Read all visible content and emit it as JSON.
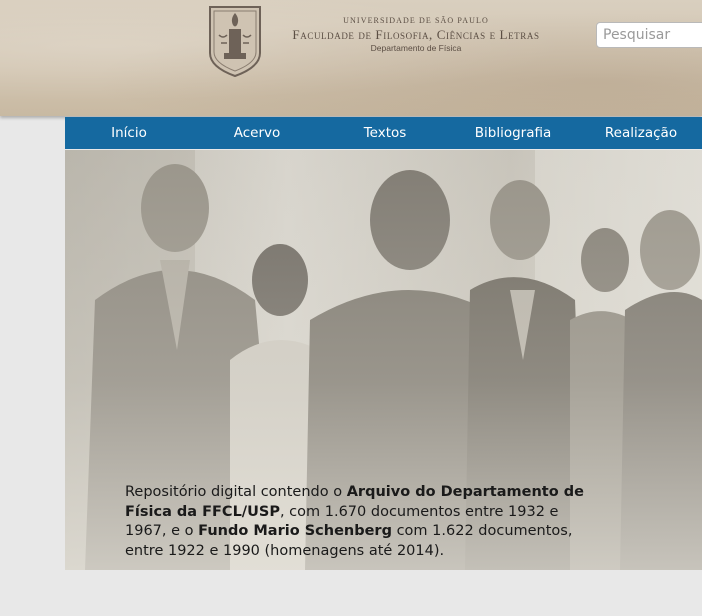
{
  "header": {
    "logo": {
      "university": "UNIVERSIDADE DE SÃO PAULO",
      "faculty": "Faculdade de Filosofia, Ciências e Letras",
      "department": "Departamento de Física",
      "crest_icon": "torch-crest-icon"
    },
    "search": {
      "placeholder": "Pesquisar"
    }
  },
  "nav": {
    "items": [
      {
        "label": "Início"
      },
      {
        "label": "Acervo"
      },
      {
        "label": "Textos"
      },
      {
        "label": "Bibliografia"
      },
      {
        "label": "Realização"
      }
    ]
  },
  "hero": {
    "image_desc_icon": "historic-group-photo",
    "caption": {
      "part1": "Repositório digital contendo o ",
      "bold1": "Arquivo do Departamento de Física da FFCL/USP",
      "part2": ", com 1.670 documentos entre 1932 e 1967, e o ",
      "bold2": "Fundo Mario Schenberg",
      "part3": " com 1.622 documentos, entre 1922 e 1990 (homenagens até 2014)."
    }
  },
  "colors": {
    "nav_bg": "#1569a0",
    "header_bg": "#d2c5b1",
    "page_bg": "#e8e8e8"
  }
}
